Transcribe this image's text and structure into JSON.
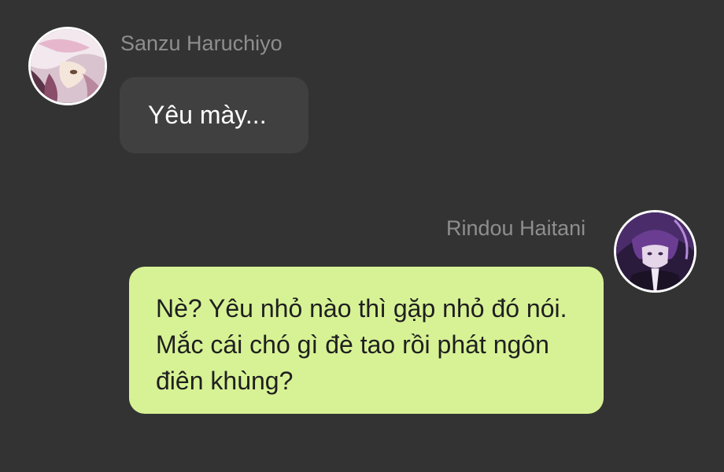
{
  "messages": [
    {
      "sender": "Sanzu Haruchiyo",
      "text": "Yêu mày...",
      "direction": "incoming",
      "avatar_icon": "sanzu-avatar-icon"
    },
    {
      "sender": "Rindou Haitani",
      "text": "Nè? Yêu nhỏ nào thì gặp nhỏ đó nói. Mắc cái chó gì đè tao rồi phát ngôn điên khùng?",
      "direction": "outgoing",
      "avatar_icon": "rindou-avatar-icon"
    }
  ],
  "colors": {
    "background": "#333333",
    "incoming_bubble": "#404040",
    "outgoing_bubble": "#d7f295",
    "sender_name": "#8e8e8e"
  }
}
